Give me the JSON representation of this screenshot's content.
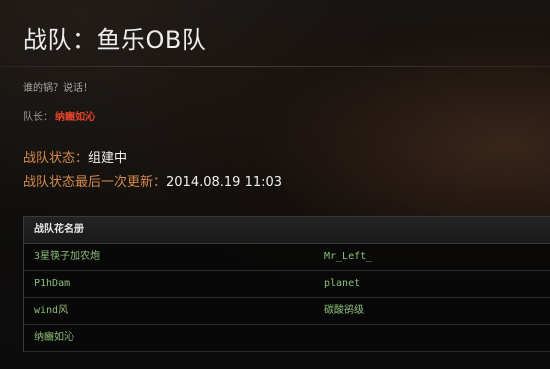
{
  "team": {
    "title": "战队：鱼乐OB队",
    "motto": "谁的锅？说话！",
    "leader_label": "队长：",
    "leader_name": "纳豳如沁"
  },
  "status": {
    "state_label": "战队状态：",
    "state_value": "组建中",
    "updated_label": "战队状态最后一次更新：",
    "updated_value": "2014.08.19 11:03"
  },
  "roster": {
    "header": "战队花名册",
    "rows": [
      [
        "3星筷子加农炮",
        "Mr_Left_"
      ],
      [
        "P1hDam",
        "planet"
      ],
      [
        "wind风",
        "碳酸鹆级"
      ],
      [
        "纳豳如沁",
        ""
      ]
    ]
  },
  "colors": {
    "accent_orange": "#d58a4a",
    "leader_red": "#e8442a",
    "member_green": "#8fbf7a"
  }
}
